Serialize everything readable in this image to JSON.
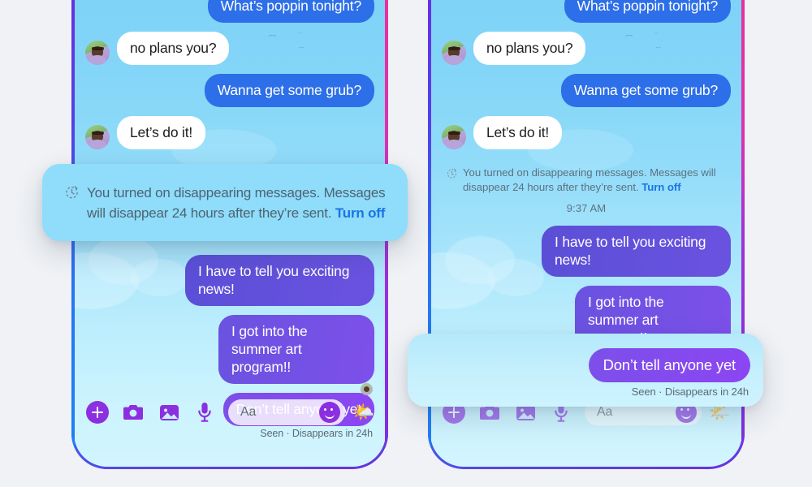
{
  "page": {
    "background_color": "#f0f2f5",
    "accent_blue": "#2d6fe8",
    "accent_purple": "#8b46f2",
    "link_blue": "#1b74e4",
    "notification_card_color": "#8fdcfb"
  },
  "conversation": {
    "messages": [
      {
        "id": "m1",
        "direction": "outgoing",
        "style": "blue",
        "text": "What’s poppin tonight?",
        "avatar": false
      },
      {
        "id": "m2",
        "direction": "incoming",
        "style": "white",
        "text": "no plans you?",
        "avatar": true
      },
      {
        "id": "m3",
        "direction": "outgoing",
        "style": "blue",
        "text": "Wanna get some grub?",
        "avatar": false
      },
      {
        "id": "m4",
        "direction": "incoming",
        "style": "white",
        "text": "Let’s do it!",
        "avatar": true
      },
      {
        "id": "m5",
        "direction": "outgoing",
        "style": "grad1",
        "text": "I have to tell you exciting news!",
        "avatar": false
      },
      {
        "id": "m6",
        "direction": "outgoing",
        "style": "grad2",
        "text": "I got into the summer art program!!",
        "avatar": false
      },
      {
        "id": "m7",
        "direction": "outgoing",
        "style": "grad3",
        "text": "Don’t tell anyone yet",
        "avatar": false
      }
    ],
    "seen_status": "Seen · Disappears in 24h",
    "timestamp": "9:37 AM"
  },
  "notification": {
    "icon": "timer-icon",
    "text_line1": "You turned on disappearing messages. Messages",
    "text_line2": "will disappear 24 hours after they’re sent.",
    "turn_off_label": "Turn off"
  },
  "toolbar": {
    "icons": [
      {
        "name": "add-plus-icon",
        "label": "Add"
      },
      {
        "name": "camera-icon",
        "label": "Camera"
      },
      {
        "name": "gallery-icon",
        "label": "Gallery"
      },
      {
        "name": "microphone-icon",
        "label": "Voice"
      }
    ],
    "composer_placeholder": "Aa",
    "emoji_button": "smiley-icon",
    "sticker": "🌤️"
  },
  "phones": {
    "left": {
      "label": "Phone screen before timestamp appears"
    },
    "right": {
      "label": "Phone screen with timestamp and highlighted message"
    }
  }
}
